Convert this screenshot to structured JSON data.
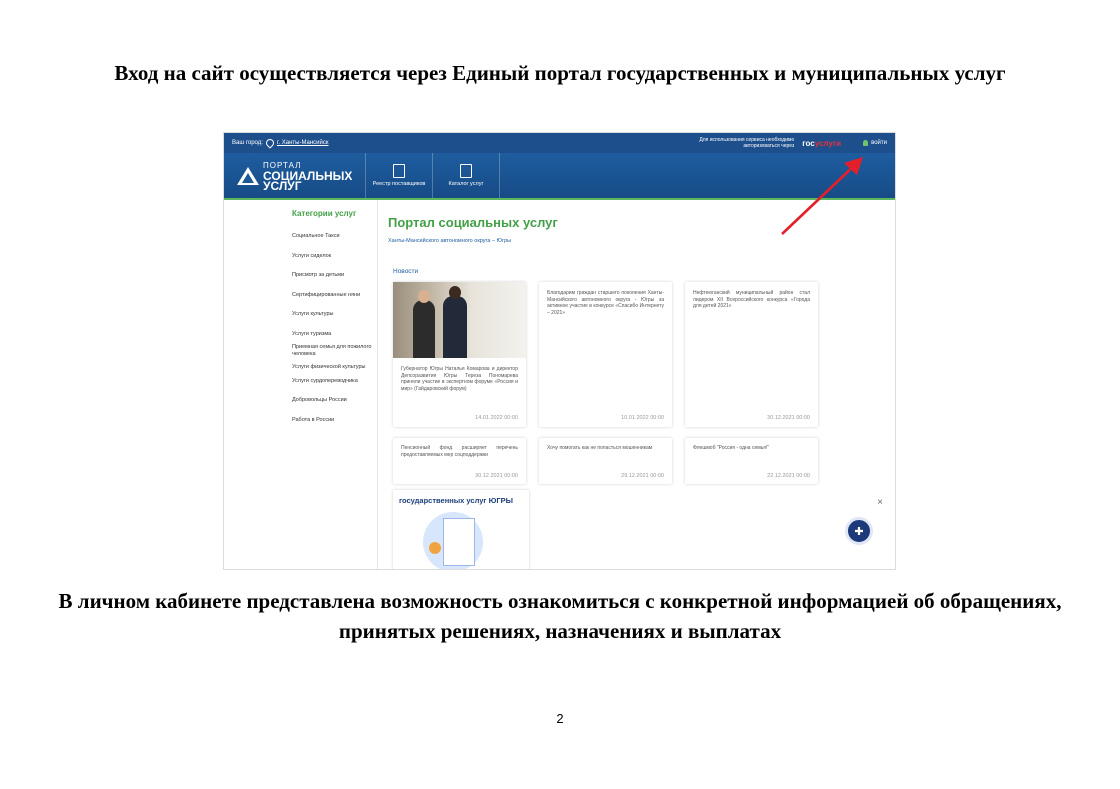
{
  "document": {
    "heading_top": "Вход на сайт осуществляется через Единый портал государственных и муниципальных услуг",
    "heading_bottom": "В личном кабинете представлена возможность ознакомиться с конкретной информацией об обращениях, принятых решениях, назначениях и выплатах",
    "page_number": "2"
  },
  "screenshot": {
    "topbar": {
      "city_label": "Ваш город:",
      "city_value": "г. Ханты-Мансийск",
      "auth_note": "Для использования сервиса необходимо авторизоваться через",
      "gos_a": "гос",
      "gos_b": "услуги",
      "login_label": "войти"
    },
    "logo": {
      "line1": "ПОРТАЛ",
      "line2": "СОЦИАЛЬНЫХ",
      "line3": "УСЛУГ"
    },
    "nav": [
      {
        "label": "Реестр поставщиков"
      },
      {
        "label": "Каталог услуг"
      }
    ],
    "sidebar": {
      "title": "Категории услуг",
      "items": [
        "Социальное Такси",
        "Услуги сиделок",
        "Присмотр за детьми",
        "Сертифицированные няни",
        "Услуги культуры",
        "Услуги туризма",
        "Приемная семья для пожилого человека",
        "Услуги физической культуры",
        "Услуги сурдопереводчика",
        "Добровольцы России",
        "Работа в России"
      ]
    },
    "main": {
      "title": "Портал социальных услуг",
      "subtitle": "Ханты-Мансийского автономного округа – Югры",
      "news_label": "Новости",
      "cards": [
        {
          "text": "Губернатор Югры Наталья Комарова и директор Депсоразвития Югры Тереза Пономарева приняли участие в экспертном форуме «Россия и мир» (Гайдаровский форум)",
          "date": "14.01.2022 00:00"
        },
        {
          "text": "Благодарим граждан старшего поколения Ханты-Мансийского автономного округа - Югры за активное участие в конкурсе «Спасибо Интернету – 2021»",
          "date": "10.01.2022 00:00"
        },
        {
          "text": "Нефтеюганский муниципальный район стал лидером XII Всероссийского конкурса «Города для детей 2021»",
          "date": "30.12.2021 00:00"
        },
        {
          "text": "Пенсионный фонд расширяет перечень предоставляемых мер соцподдержки",
          "date": "30.12.2021 00:00"
        },
        {
          "text": "Хочу помогать как не попасться мошенникам",
          "date": "29.12.2021 00:00"
        },
        {
          "text": "Флешмоб \"Россия - одна семья!\"",
          "date": "22.12.2021 00:00"
        }
      ],
      "banner_text": "государственных услуг ЮГРЫ",
      "close_glyph": "×",
      "fab_glyph": "✚"
    }
  }
}
